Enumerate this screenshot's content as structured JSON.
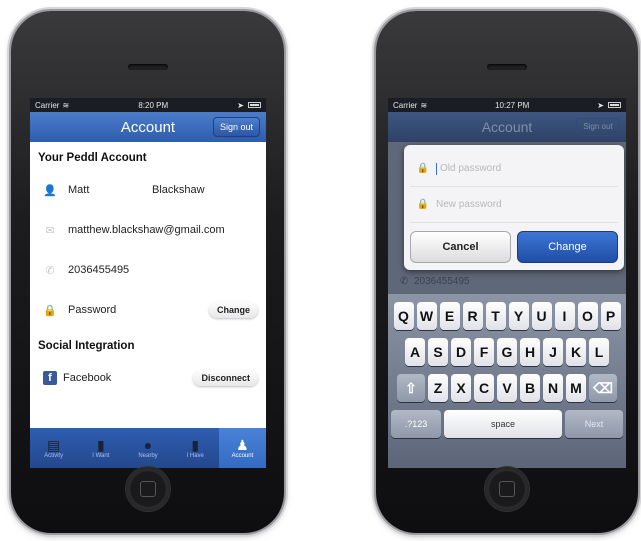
{
  "phone1": {
    "status": {
      "carrier": "Carrier",
      "time": "8:20 PM"
    },
    "nav": {
      "title": "Account",
      "sign_out": "Sign out"
    },
    "section1": "Your Peddl Account",
    "first_name": "Matt",
    "last_name": "Blackshaw",
    "email": "matthew.blackshaw@gmail.com",
    "phone": "2036455495",
    "password_label": "Password",
    "change_btn": "Change",
    "section2": "Social Integration",
    "facebook_label": "Facebook",
    "disconnect_btn": "Disconnect",
    "tabs": [
      {
        "label": "Activity",
        "icon": "inbox-icon"
      },
      {
        "label": "I Want",
        "icon": "bag-icon"
      },
      {
        "label": "Nearby",
        "icon": "location-icon"
      },
      {
        "label": "I Have",
        "icon": "tag-icon"
      },
      {
        "label": "Account",
        "icon": "person-icon"
      }
    ]
  },
  "phone2": {
    "status": {
      "carrier": "Carrier",
      "time": "10:27 PM"
    },
    "nav": {
      "title": "Account",
      "sign_out": "Sign out"
    },
    "old_password_placeholder": "Old password",
    "new_password_placeholder": "New password",
    "cancel_btn": "Cancel",
    "change_btn": "Change",
    "bg_phone": "2036455495",
    "keyboard": {
      "row1": [
        "Q",
        "W",
        "E",
        "R",
        "T",
        "Y",
        "U",
        "I",
        "O",
        "P"
      ],
      "row2": [
        "A",
        "S",
        "D",
        "F",
        "G",
        "H",
        "J",
        "K",
        "L"
      ],
      "row3": [
        "Z",
        "X",
        "C",
        "V",
        "B",
        "N",
        "M"
      ],
      "k123": ".?123",
      "space": "space",
      "next": "Next"
    }
  },
  "colors": {
    "nav_blue": "#2f5cad",
    "facebook": "#3b5998",
    "tab_active": "#4a82d9"
  }
}
